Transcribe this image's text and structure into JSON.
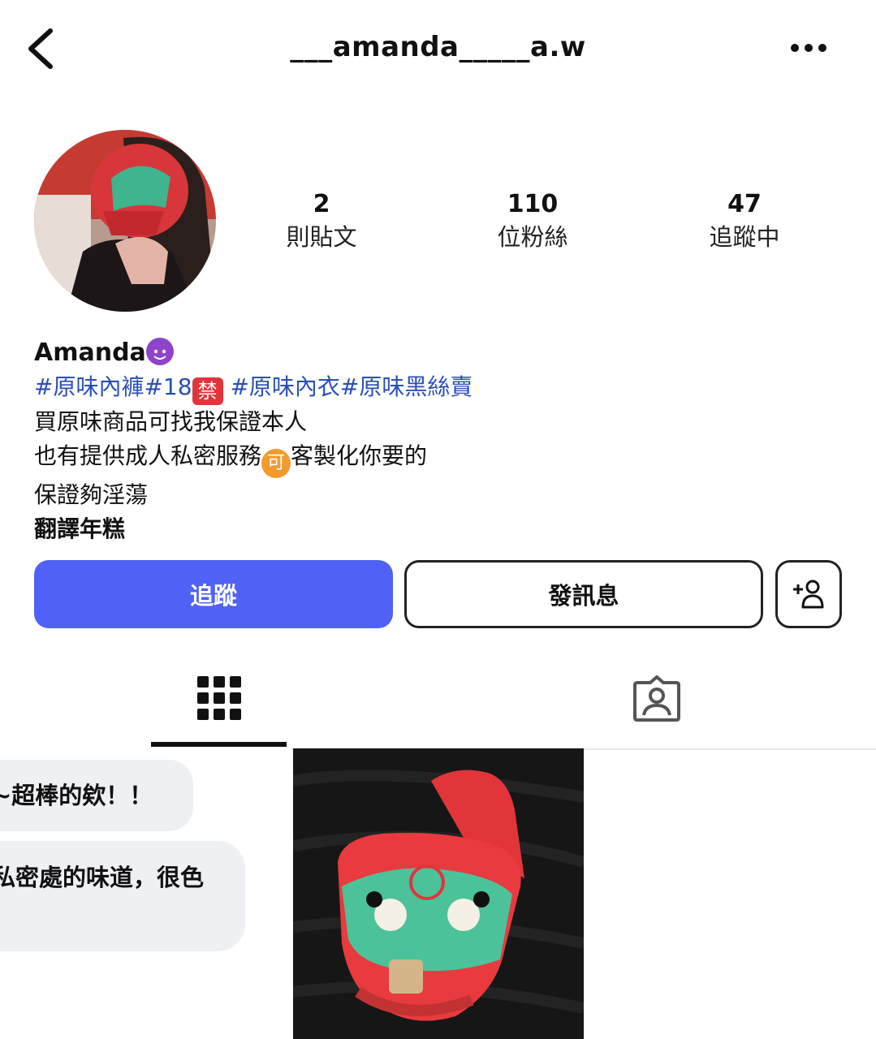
{
  "header": {
    "username": "___amanda_____a.w",
    "back_icon": "chevron-left-icon",
    "more_icon": "more-horizontal-icon"
  },
  "stats": [
    {
      "value": "2",
      "label": "則貼文"
    },
    {
      "value": "110",
      "label": "位粉絲"
    },
    {
      "value": "47",
      "label": "追蹤中"
    }
  ],
  "bio": {
    "name": "Amanda",
    "name_emoji": "smiling-devil-emoji",
    "tags_part1": "#原味內褲#18",
    "tags_badge": "禁",
    "tags_part2": " #原味內衣#原味黑絲賣",
    "line1": "買原味商品可找我保證本人",
    "line2_a": "也有提供成人私密服務",
    "line2_badge": "可",
    "line2_b": "客製化你要的",
    "line3": "保證夠淫蕩",
    "translate": "翻譯年糕"
  },
  "actions": {
    "follow_label": "追蹤",
    "message_label": "發訊息",
    "add_icon": "add-person-icon"
  },
  "tabs": {
    "grid_icon": "grid-icon",
    "tagged_icon": "tagged-person-icon"
  },
  "posts": {
    "post1_bubble1": "~超棒的欸！！",
    "post1_bubble2": "私密處的味道，很色"
  },
  "colors": {
    "accent": "#4f62f5",
    "hashtag": "#2a4fb5"
  }
}
